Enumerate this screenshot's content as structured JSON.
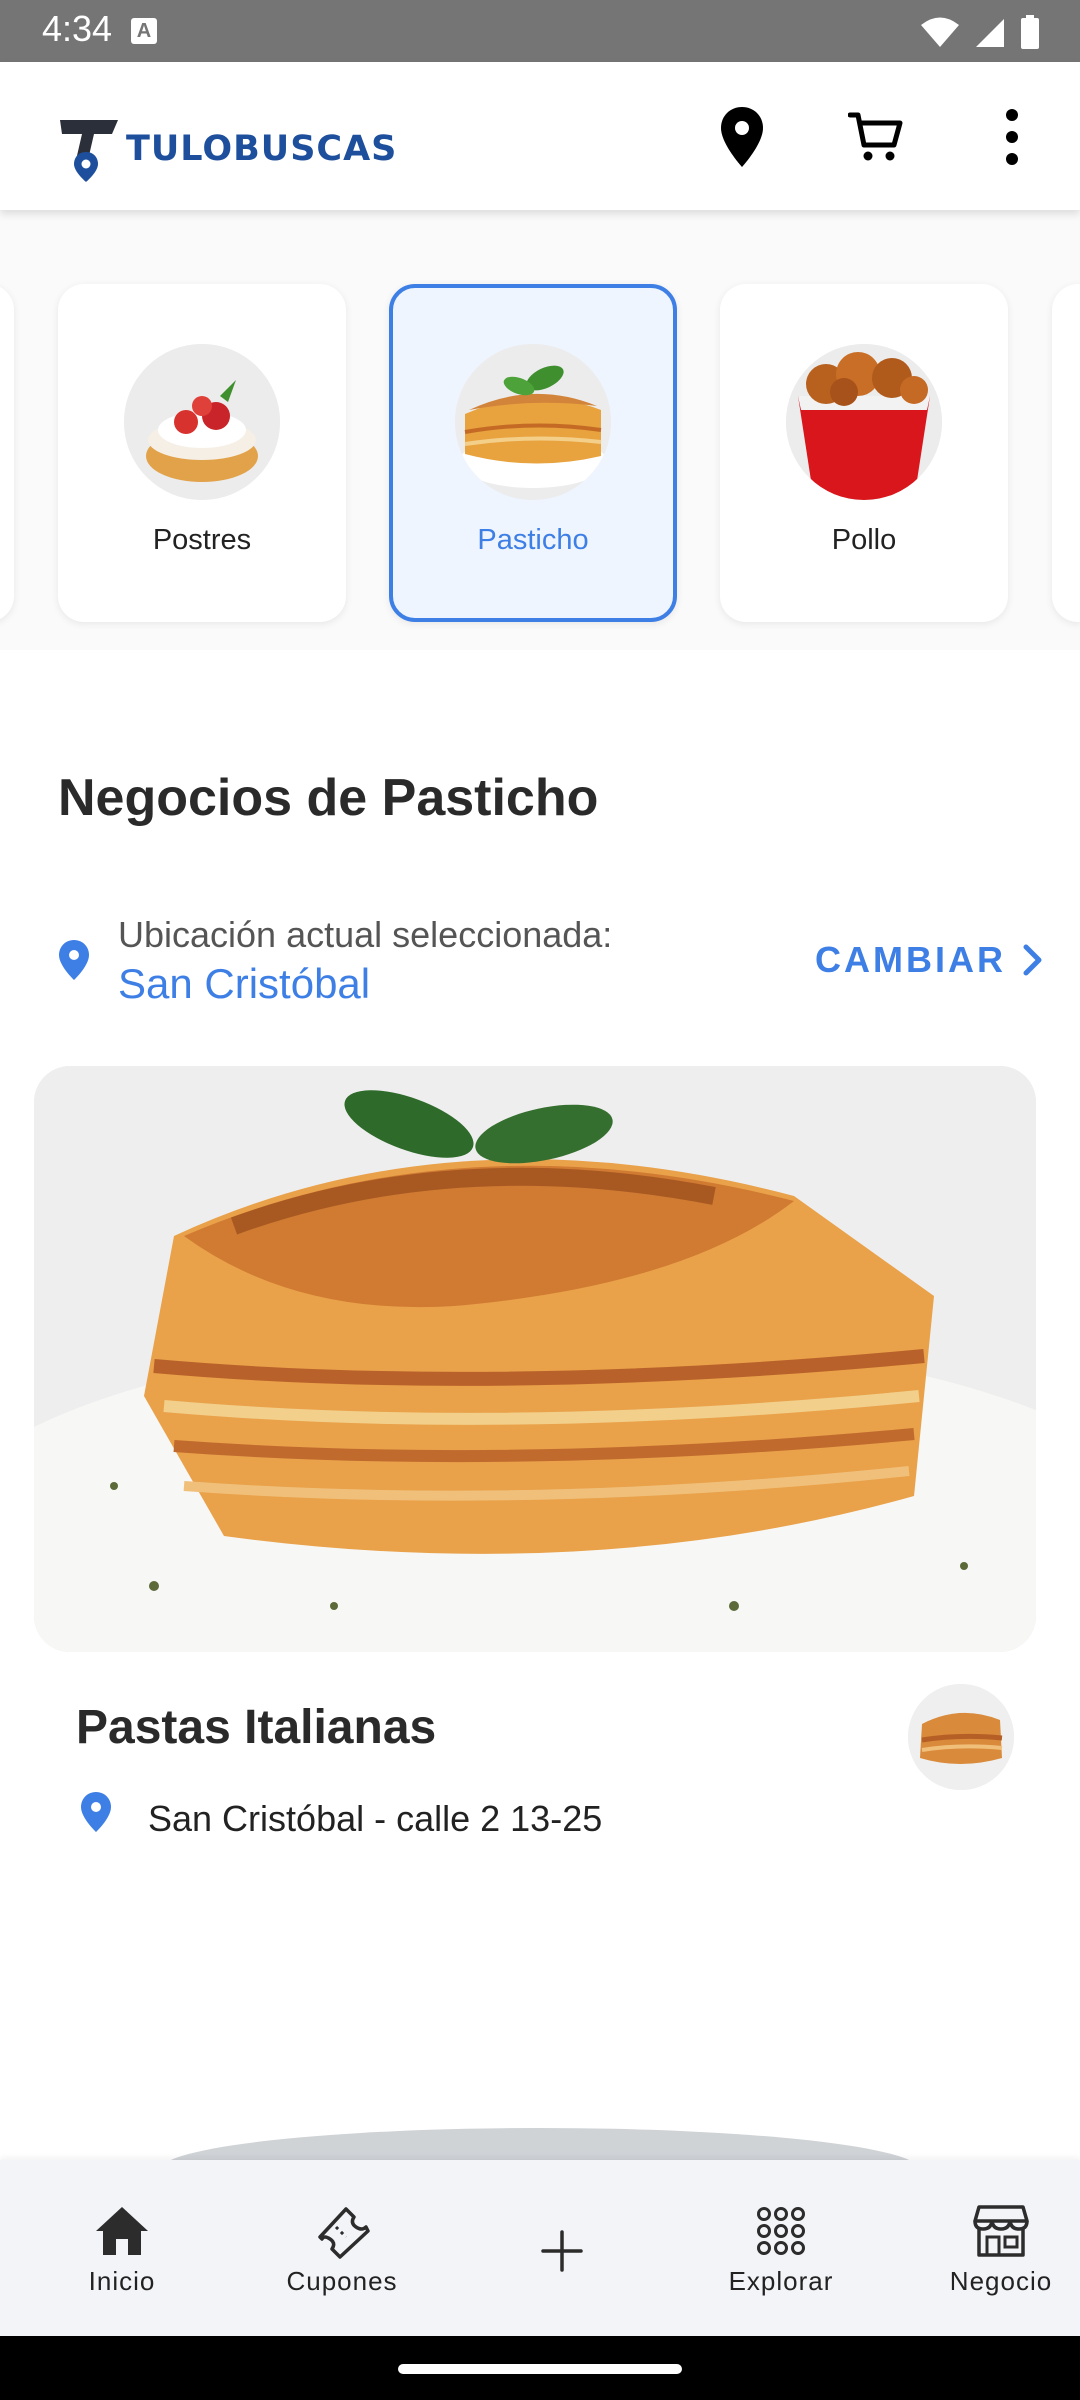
{
  "status_bar": {
    "time": "4:34",
    "indicator": "A",
    "icons": [
      "wifi-icon",
      "signal-icon",
      "battery-icon"
    ]
  },
  "app_bar": {
    "logo_text": "TULOBUSCAS",
    "actions": [
      "location-pin-icon",
      "cart-icon",
      "more-vert-icon"
    ]
  },
  "categories": [
    {
      "label": "Postres",
      "selected": false
    },
    {
      "label": "Pasticho",
      "selected": true
    },
    {
      "label": "Pollo",
      "selected": false
    }
  ],
  "section": {
    "title": "Negocios de Pasticho"
  },
  "location": {
    "caption": "Ubicación actual seleccionada:",
    "value": "San Cristóbal",
    "change_label": "CAMBIAR"
  },
  "business": {
    "name": "Pastas Italianas",
    "address": "San Cristóbal - calle 2 13-25"
  },
  "bottom_nav": {
    "items": [
      {
        "label": "Inicio",
        "icon": "home-icon"
      },
      {
        "label": "Cupones",
        "icon": "ticket-icon"
      },
      {
        "label": "",
        "icon": "plus-icon"
      },
      {
        "label": "Explorar",
        "icon": "grid-dots-icon"
      },
      {
        "label": "Negocio",
        "icon": "store-icon"
      }
    ]
  },
  "colors": {
    "accent": "#3e7fe6",
    "brand": "#1e4f9c",
    "status_bar": "#757575"
  }
}
